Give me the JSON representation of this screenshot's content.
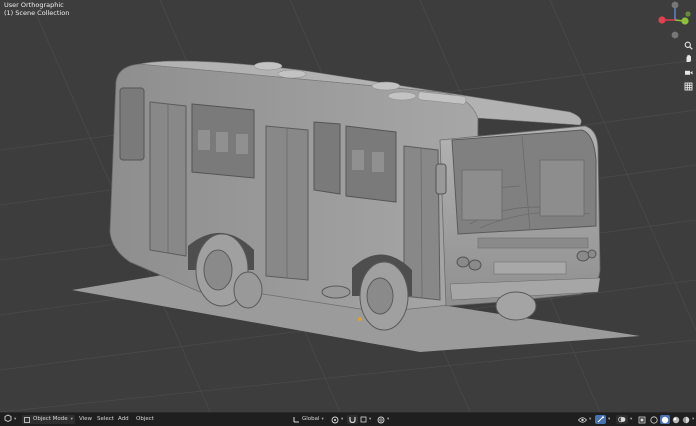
{
  "viewport": {
    "view_name": "User Orthographic",
    "collection_label": "(1) Scene Collection",
    "background_color": "#3d3d3d",
    "model_color": "#9c9c9c"
  },
  "gizmo": {
    "x_color": "#e0404f",
    "y_color": "#8bc23a",
    "z_color": "#5b8ad8",
    "neutral_color": "#777777"
  },
  "nav_tools": [
    "zoom-icon",
    "hand-pan-icon",
    "camera-icon",
    "grid-icon"
  ],
  "header": {
    "editor_type_icon": "view3d-icon",
    "mode": "Object Mode",
    "menus": [
      "View",
      "Select",
      "Add",
      "Object"
    ],
    "transform_orientation": "Global",
    "pivot_icon": "pivot-icon",
    "snap_icon": "magnet-icon",
    "proportional_icon": "proportional-icon",
    "right_icons": [
      "visibility-icon",
      "gizmo-icon",
      "overlay-icon",
      "xray-icon",
      "wireframe-shading-icon",
      "solid-shading-icon",
      "material-shading-icon",
      "rendered-shading-icon"
    ]
  }
}
